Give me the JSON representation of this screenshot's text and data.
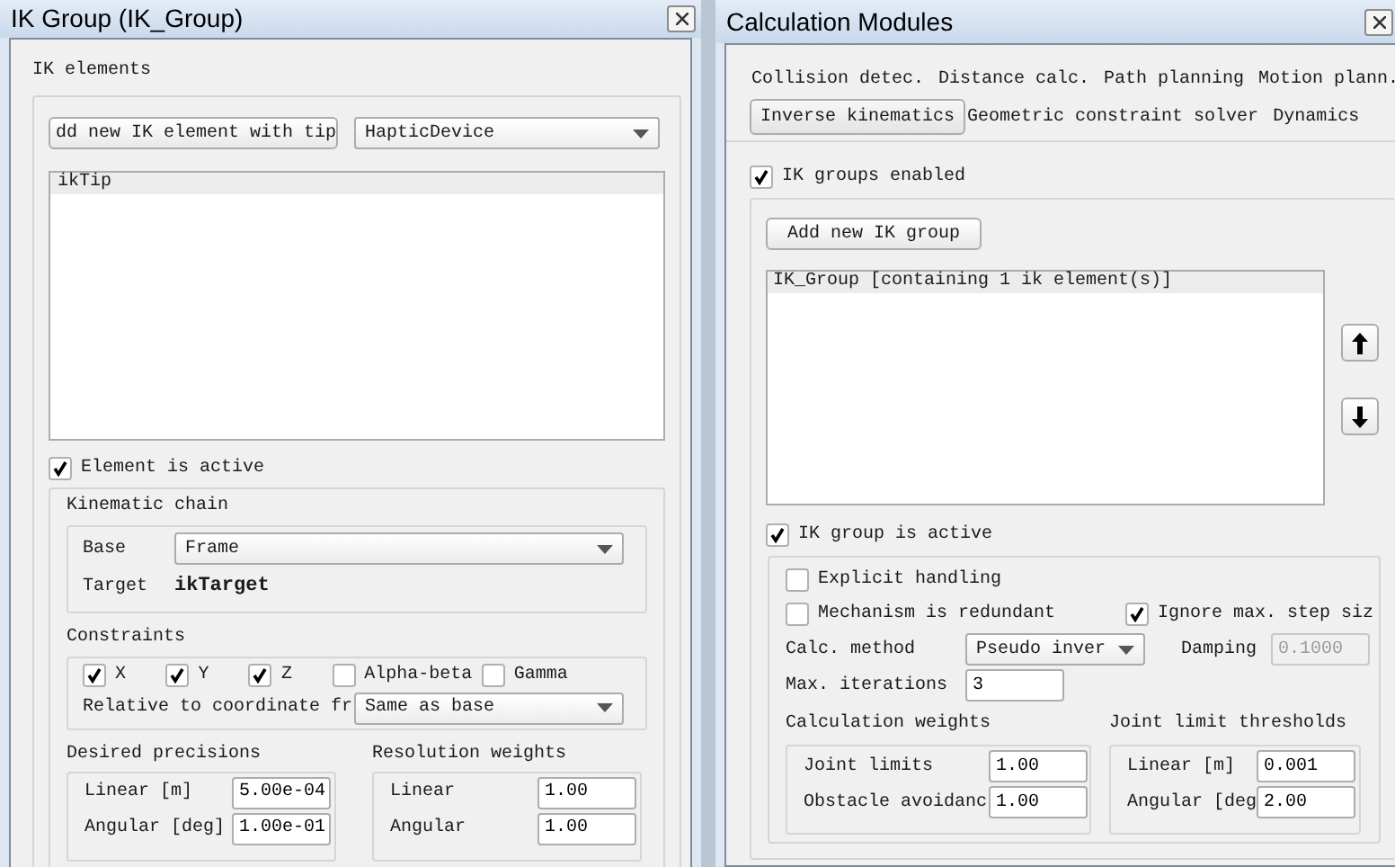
{
  "left_window": {
    "title": "IK Group (IK_Group)",
    "ik_elements": {
      "label": "IK elements",
      "add_button": "dd new IK element with tip",
      "tip_dropdown": "HapticDevice",
      "list": [
        {
          "label": "ikTip",
          "selected": true
        }
      ]
    },
    "element_active": {
      "label": "Element is active",
      "checked": true
    },
    "kinematic_chain": {
      "label": "Kinematic chain",
      "base_label": "Base",
      "base_value": "Frame",
      "target_label": "Target",
      "target_value": "ikTarget"
    },
    "constraints": {
      "label": "Constraints",
      "items": [
        {
          "label": "X",
          "checked": true
        },
        {
          "label": "Y",
          "checked": true
        },
        {
          "label": "Z",
          "checked": true
        },
        {
          "label": "Alpha-beta",
          "checked": false
        },
        {
          "label": "Gamma",
          "checked": false
        }
      ],
      "relative_label": "Relative to coordinate fr",
      "relative_value": "Same as base"
    },
    "desired_precisions": {
      "label": "Desired precisions",
      "rows": [
        {
          "label": "Linear [m]",
          "value": "5.00e-04"
        },
        {
          "label": "Angular [deg]",
          "value": "1.00e-01"
        }
      ]
    },
    "resolution_weights": {
      "label": "Resolution weights",
      "rows": [
        {
          "label": "Linear",
          "value": "1.00"
        },
        {
          "label": "Angular",
          "value": "1.00"
        }
      ]
    }
  },
  "right_window": {
    "title": "Calculation Modules",
    "tab_rows": [
      [
        {
          "label": "Collision detec.",
          "selected": false
        },
        {
          "label": "Distance calc.",
          "selected": false
        },
        {
          "label": "Path planning",
          "selected": false
        },
        {
          "label": "Motion plann.",
          "selected": false
        }
      ],
      [
        {
          "label": "Inverse kinematics",
          "selected": true
        },
        {
          "label": "Geometric constraint solver",
          "selected": false
        },
        {
          "label": "Dynamics",
          "selected": false
        }
      ]
    ],
    "groups_enabled": {
      "label": "IK groups enabled",
      "checked": true
    },
    "add_button": "Add new IK group",
    "group_list": [
      {
        "label": "IK_Group [containing 1 ik element(s)]",
        "selected": true
      }
    ],
    "group_active": {
      "label": "IK group is active",
      "checked": true
    },
    "explicit_handling": {
      "label": "Explicit handling",
      "checked": false
    },
    "mechanism_redundant": {
      "label": "Mechanism is redundant",
      "checked": false
    },
    "ignore_step_size": {
      "label": "Ignore max. step siz",
      "checked": true
    },
    "calc_method": {
      "label": "Calc. method",
      "value": "Pseudo inver"
    },
    "damping": {
      "label": "Damping",
      "value": "0.1000",
      "disabled": true
    },
    "max_iterations": {
      "label": "Max. iterations",
      "value": "3"
    },
    "calculation_weights": {
      "label": "Calculation weights",
      "rows": [
        {
          "label": "Joint limits",
          "value": "1.00"
        },
        {
          "label": "Obstacle avoidanc",
          "value": "1.00"
        }
      ]
    },
    "joint_limit_thresholds": {
      "label": "Joint limit thresholds",
      "rows": [
        {
          "label": "Linear [m]",
          "value": "0.001"
        },
        {
          "label": "Angular [deg",
          "value": "2.00"
        }
      ]
    }
  }
}
